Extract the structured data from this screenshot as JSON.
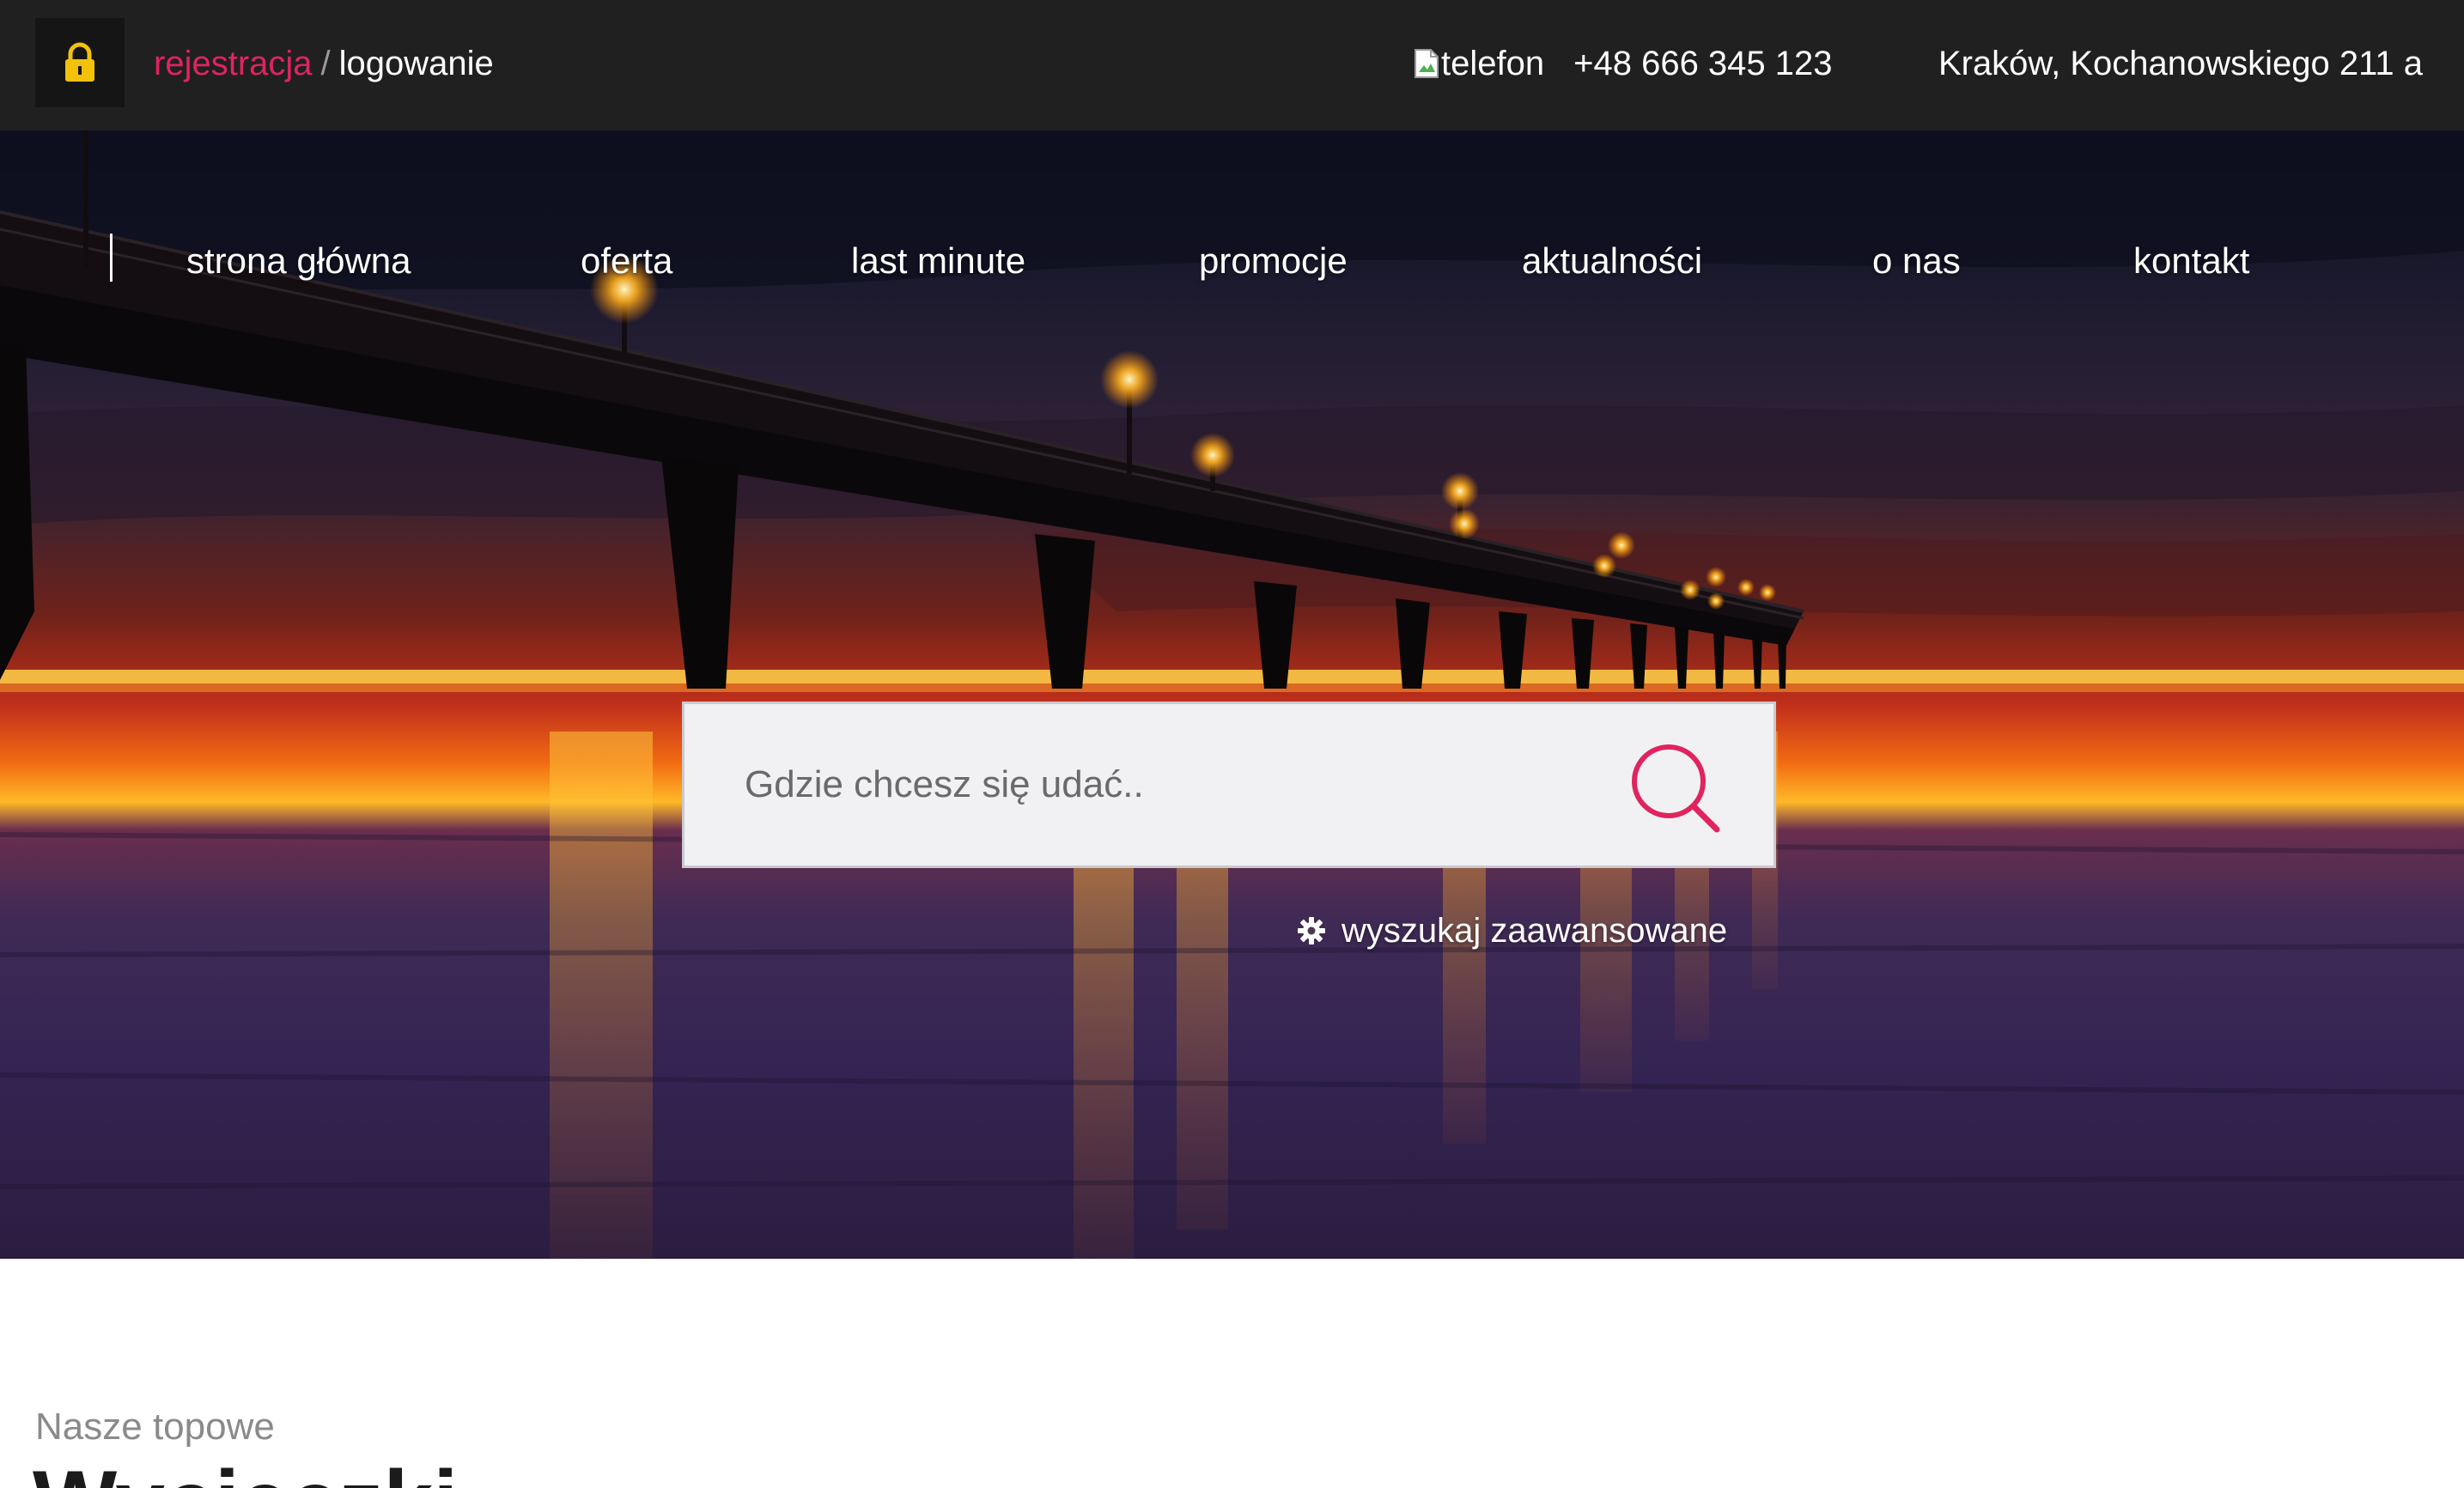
{
  "topbar": {
    "register_label": "rejestracja",
    "separator": "/",
    "login_label": "logowanie",
    "phone_image_alt": "telefon",
    "phone_number": "+48 666 345 123",
    "address": "Kraków, Kochanowskiego 211 a",
    "lock_icon": "lock-icon",
    "accent_color": "#e0245e"
  },
  "nav": {
    "items": [
      {
        "label": "strona główna"
      },
      {
        "label": "oferta"
      },
      {
        "label": "last minute"
      },
      {
        "label": "promocje"
      },
      {
        "label": "aktualności"
      },
      {
        "label": "o nas"
      },
      {
        "label": "kontakt"
      }
    ]
  },
  "search": {
    "placeholder": "Gdzie chcesz się udać..",
    "value": "",
    "button_icon": "search-icon",
    "advanced_label": "wyszukaj zaawansowane",
    "advanced_icon": "gear-icon"
  },
  "section": {
    "subtitle": "Nasze topowe",
    "title": "Wycieczki"
  }
}
